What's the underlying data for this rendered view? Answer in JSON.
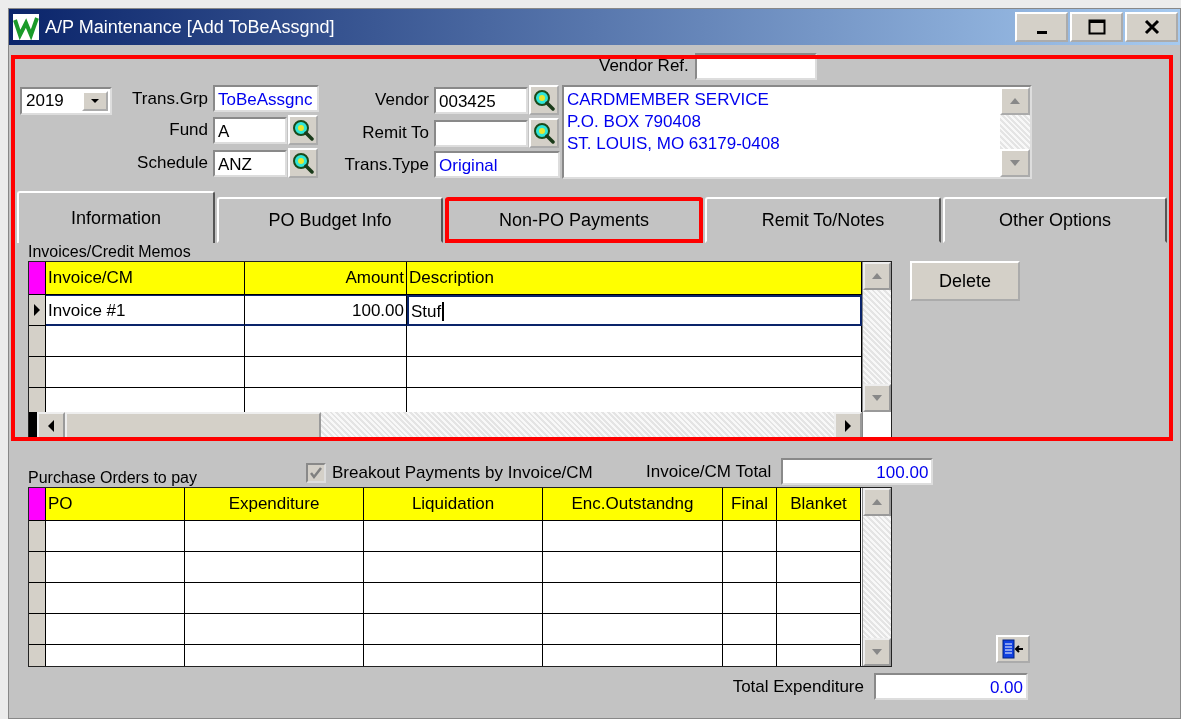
{
  "window": {
    "title": "A/P Maintenance [Add ToBeAssgnd]"
  },
  "vendor_ref": {
    "label": "Vendor Ref."
  },
  "year": {
    "value": "2019"
  },
  "left_fields": [
    {
      "label": "Trans.Grp",
      "value": "ToBeAssgnc",
      "readonly": true,
      "lookup": false
    },
    {
      "label": "Fund",
      "value": "A",
      "readonly": false,
      "lookup": true
    },
    {
      "label": "Schedule",
      "value": "ANZ",
      "readonly": false,
      "lookup": true
    }
  ],
  "right_fields": [
    {
      "label": "Vendor",
      "value": "003425",
      "readonly": false,
      "lookup": true
    },
    {
      "label": "Remit To",
      "readonly": false,
      "lookup": true
    },
    {
      "label": "Trans.Type",
      "value": "Original",
      "readonly": true,
      "lookup": false
    }
  ],
  "address": {
    "lines": [
      "CARDMEMBER SERVICE",
      "P.O. BOX 790408",
      "ST. LOUIS, MO  63179-0408"
    ]
  },
  "tabs": [
    {
      "label": "Information",
      "selected": true,
      "highlighted": false
    },
    {
      "label": "PO Budget Info",
      "selected": false,
      "highlighted": false
    },
    {
      "label": "Non-PO Payments",
      "selected": false,
      "highlighted": true
    },
    {
      "label": "Remit To/Notes",
      "selected": false,
      "highlighted": false
    },
    {
      "label": "Other Options",
      "selected": false,
      "highlighted": false
    }
  ],
  "invoices": {
    "title": "Invoices/Credit Memos",
    "columns": [
      {
        "label": "Invoice/CM",
        "kind": "text"
      },
      {
        "label": "Amount",
        "kind": "amount"
      },
      {
        "label": "Description",
        "kind": "text"
      }
    ],
    "rows": [
      {
        "current": true,
        "cells": [
          {
            "text": "Invoice #1",
            "editing": false
          },
          {
            "text": "100.00",
            "editing": false
          },
          {
            "text": "Stuf",
            "editing": true
          }
        ]
      },
      {
        "current": false
      },
      {
        "current": false
      },
      {
        "current": false
      }
    ]
  },
  "delete_button": {
    "label": "Delete"
  },
  "purchase_orders_label": "Purchase Orders to pay",
  "breakout_checkbox": {
    "label": "Breakout Payments by Invoice/CM",
    "checked": true,
    "disabled": true
  },
  "invoice_total": {
    "label": "Invoice/CM Total",
    "value": "100.00"
  },
  "purchase_orders": {
    "columns": [
      {
        "label": "PO",
        "kind": "text"
      },
      {
        "label": "Expenditure",
        "kind": "center"
      },
      {
        "label": "Liquidation",
        "kind": "center"
      },
      {
        "label": "Enc.Outstandng",
        "kind": "center"
      },
      {
        "label": "Final",
        "kind": "center"
      },
      {
        "label": "Blanket",
        "kind": "center"
      }
    ],
    "rows": [
      {
        "current": false
      },
      {
        "current": false
      },
      {
        "current": false
      },
      {
        "current": false
      },
      {
        "current": false
      }
    ]
  },
  "total_expenditure": {
    "label": "Total Expenditure",
    "value": "0.00"
  }
}
